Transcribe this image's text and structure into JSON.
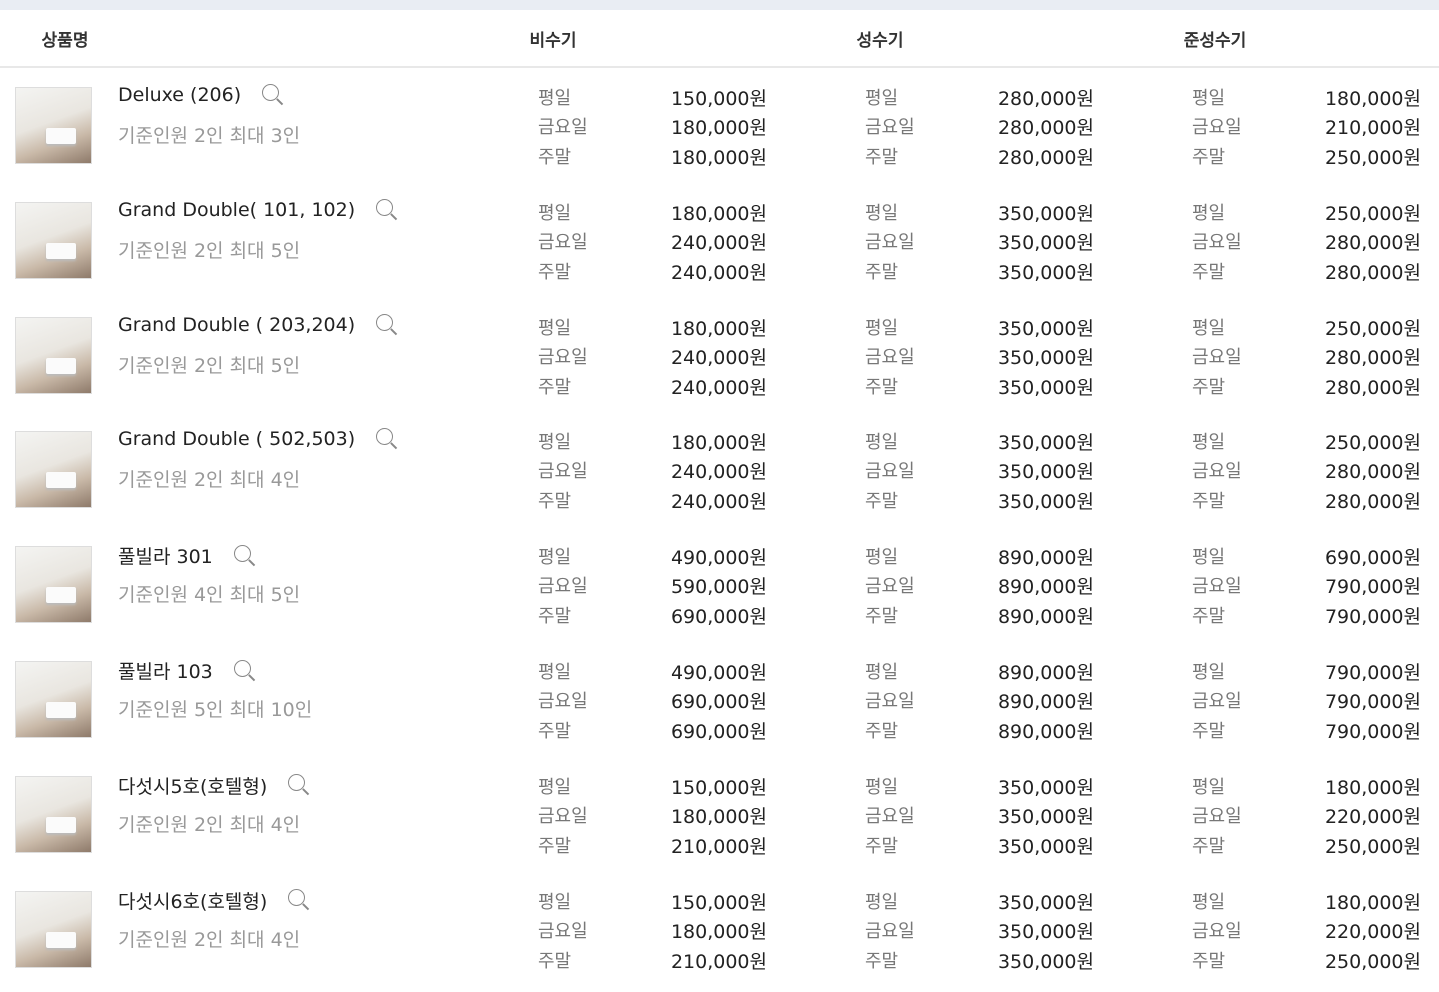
{
  "header": {
    "product": "상품명",
    "seasons": [
      "비수기",
      "성수기",
      "준성수기"
    ]
  },
  "day_labels": [
    "평일",
    "금요일",
    "주말"
  ],
  "rows": [
    {
      "name": "Deluxe (206)",
      "capacity": "기준인원 2인 최대 3인",
      "prices": [
        [
          "150,000원",
          "180,000원",
          "180,000원"
        ],
        [
          "280,000원",
          "280,000원",
          "280,000원"
        ],
        [
          "180,000원",
          "210,000원",
          "250,000원"
        ]
      ]
    },
    {
      "name": "Grand Double( 101, 102)",
      "capacity": "기준인원 2인 최대 5인",
      "prices": [
        [
          "180,000원",
          "240,000원",
          "240,000원"
        ],
        [
          "350,000원",
          "350,000원",
          "350,000원"
        ],
        [
          "250,000원",
          "280,000원",
          "280,000원"
        ]
      ]
    },
    {
      "name": "Grand Double ( 203,204)",
      "capacity": "기준인원 2인 최대 5인",
      "prices": [
        [
          "180,000원",
          "240,000원",
          "240,000원"
        ],
        [
          "350,000원",
          "350,000원",
          "350,000원"
        ],
        [
          "250,000원",
          "280,000원",
          "280,000원"
        ]
      ]
    },
    {
      "name": "Grand Double ( 502,503)",
      "capacity": "기준인원 2인 최대 4인",
      "prices": [
        [
          "180,000원",
          "240,000원",
          "240,000원"
        ],
        [
          "350,000원",
          "350,000원",
          "350,000원"
        ],
        [
          "250,000원",
          "280,000원",
          "280,000원"
        ]
      ]
    },
    {
      "name": "풀빌라 301",
      "capacity": "기준인원 4인 최대 5인",
      "prices": [
        [
          "490,000원",
          "590,000원",
          "690,000원"
        ],
        [
          "890,000원",
          "890,000원",
          "890,000원"
        ],
        [
          "690,000원",
          "790,000원",
          "790,000원"
        ]
      ]
    },
    {
      "name": "풀빌라 103",
      "capacity": "기준인원 5인 최대 10인",
      "prices": [
        [
          "490,000원",
          "690,000원",
          "690,000원"
        ],
        [
          "890,000원",
          "890,000원",
          "890,000원"
        ],
        [
          "790,000원",
          "790,000원",
          "790,000원"
        ]
      ]
    },
    {
      "name": "다섯시5호(호텔형)",
      "capacity": "기준인원 2인 최대 4인",
      "prices": [
        [
          "150,000원",
          "180,000원",
          "210,000원"
        ],
        [
          "350,000원",
          "350,000원",
          "350,000원"
        ],
        [
          "180,000원",
          "220,000원",
          "250,000원"
        ]
      ]
    },
    {
      "name": "다섯시6호(호텔형)",
      "capacity": "기준인원 2인 최대 4인",
      "prices": [
        [
          "150,000원",
          "180,000원",
          "210,000원"
        ],
        [
          "350,000원",
          "350,000원",
          "350,000원"
        ],
        [
          "180,000원",
          "220,000원",
          "250,000원"
        ]
      ]
    }
  ]
}
